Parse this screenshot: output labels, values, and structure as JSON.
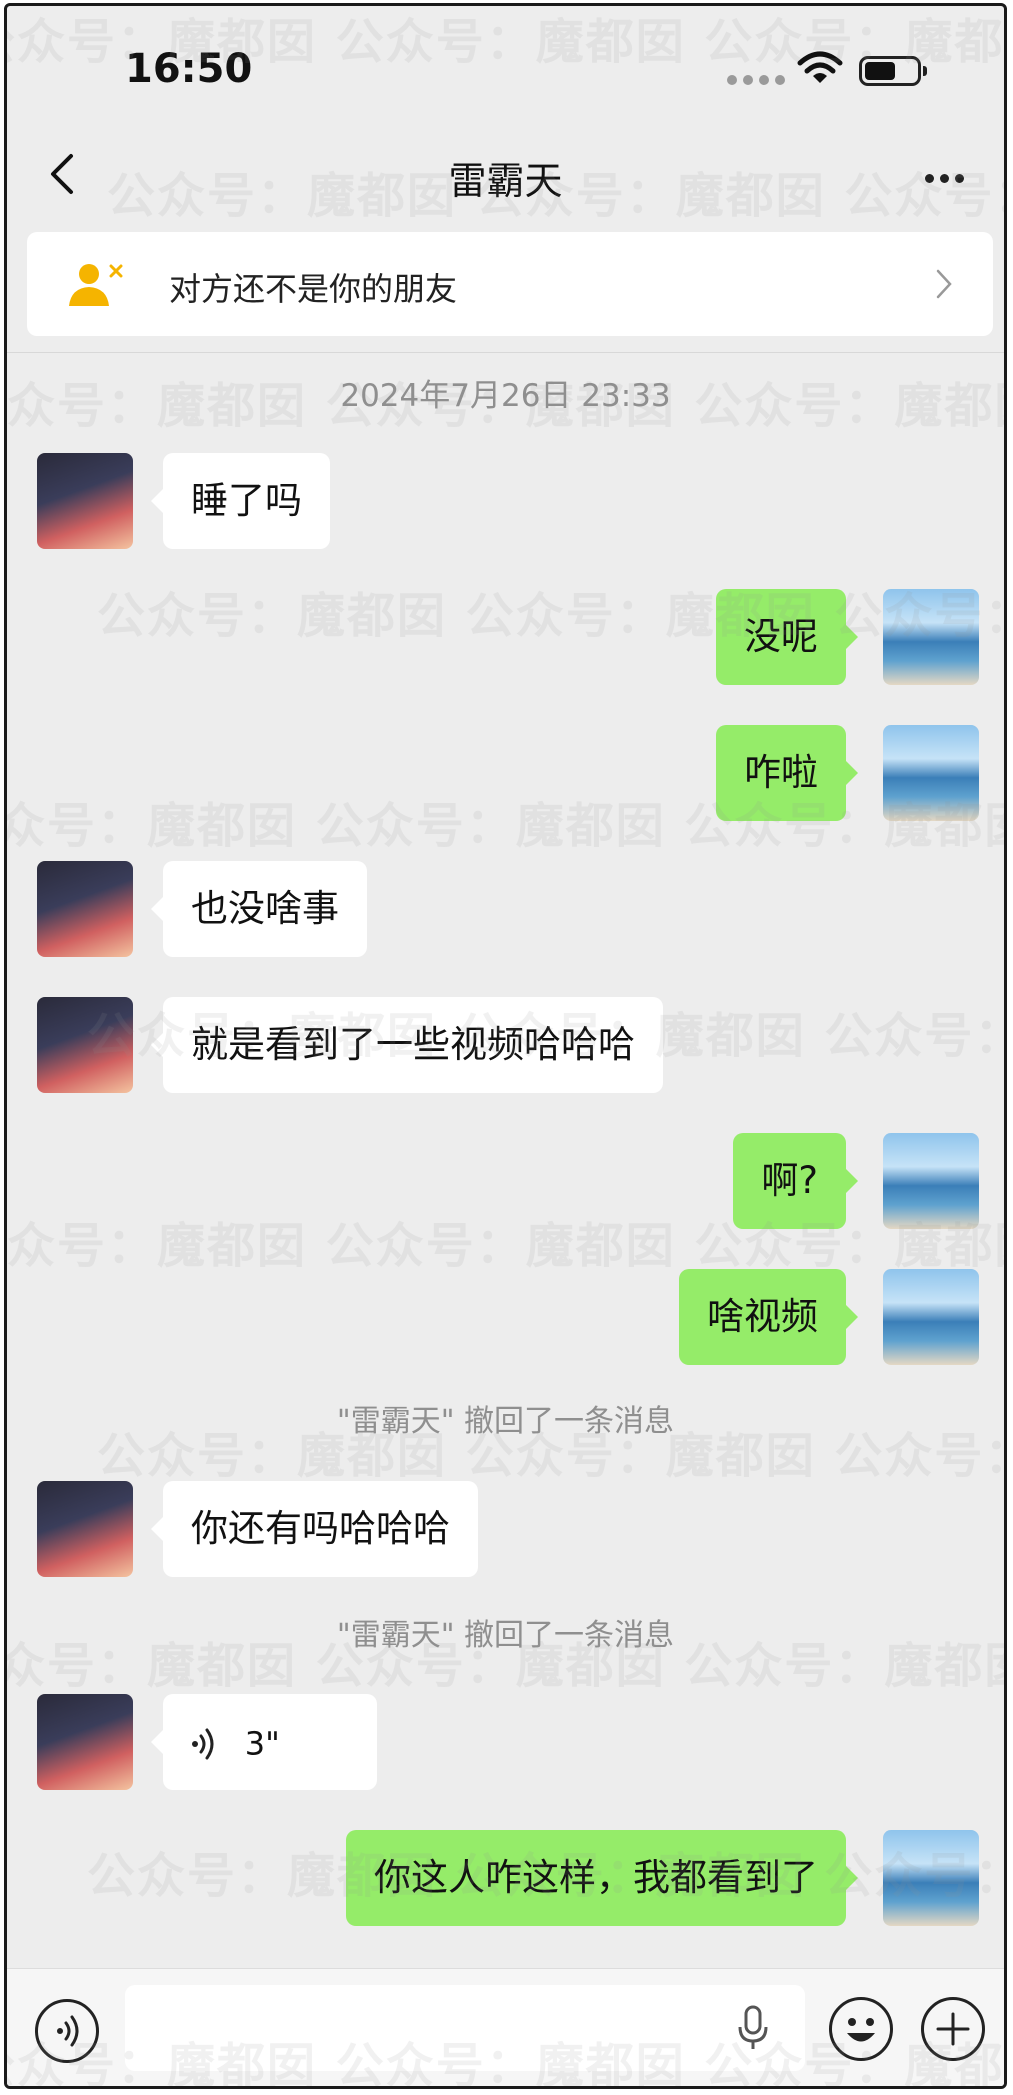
{
  "status_bar": {
    "time": "16:50"
  },
  "nav": {
    "title": "雷霸天"
  },
  "banner": {
    "text": "对方还不是你的朋友"
  },
  "chat": {
    "timestamp": "2024年7月26日 23:33",
    "messages": [
      {
        "side": "left",
        "text": "睡了吗"
      },
      {
        "side": "right",
        "text": "没呢"
      },
      {
        "side": "right",
        "text": "咋啦"
      },
      {
        "side": "left",
        "text": "也没啥事"
      },
      {
        "side": "left",
        "text": "就是看到了一些视频哈哈哈"
      },
      {
        "side": "right",
        "text": "啊?"
      },
      {
        "side": "right",
        "text": "啥视频"
      },
      {
        "side": "left",
        "text": "你还有吗哈哈哈"
      },
      {
        "side": "left",
        "voice_duration": "3\""
      },
      {
        "side": "right",
        "text": "你这人咋这样，我都看到了"
      }
    ],
    "recall_notices": [
      "\"雷霸天\" 撤回了一条消息",
      "\"雷霸天\" 撤回了一条消息"
    ]
  },
  "watermark": {
    "text": "公众号：魔都囡"
  },
  "icons": {
    "back": "chevron-left-icon",
    "more": "more-dots-icon",
    "banner": "user-not-friend-icon",
    "voice_mode": "voice-mode-icon",
    "mic": "mic-icon",
    "emoji": "emoji-icon",
    "add": "plus-icon"
  },
  "colors": {
    "chat_background": "#ededed",
    "sent_bubble": "#95ec69",
    "received_bubble": "#ffffff",
    "banner_icon": "#f5b400"
  }
}
